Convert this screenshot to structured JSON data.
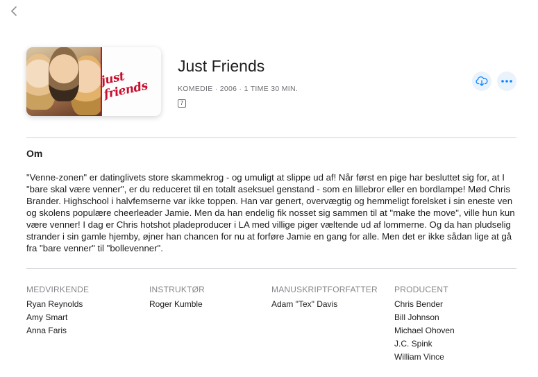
{
  "movie": {
    "title": "Just Friends",
    "meta": "KOMEDIE · 2006 · 1 TIME 30 MIN.",
    "rating": "7",
    "poster_title": "just friends"
  },
  "about": {
    "heading": "Om",
    "text": "\"Venne-zonen\" er datinglivets store skammekrog - og umuligt at slippe ud af! Når først en pige har besluttet sig for, at I \"bare skal være venner\", er du reduceret til en totalt aseksuel genstand - som en lillebror eller en bordlampe! Mød Chris Brander. Highschool i halvfemserne var ikke toppen. Han var genert, overvægtig og hemmeligt forelsket i sin eneste ven og skolens populære cheerleader Jamie. Men da han endelig fik nosset sig sammen til at \"make the move\", ville hun kun være venner! I dag er Chris hotshot pladeproducer i LA med villige piger væltende ud af lommerne. Og da han pludselig strander i sin gamle hjemby, øjner han chancen for nu at forføre Jamie en gang for alle. Men det er ikke sådan lige at gå fra \"bare venner\" til \"bollevenner\"."
  },
  "credits": {
    "cast": {
      "heading": "MEDVIRKENDE",
      "names": [
        "Ryan Reynolds",
        "Amy Smart",
        "Anna Faris"
      ]
    },
    "director": {
      "heading": "INSTRUKTØR",
      "names": [
        "Roger Kumble"
      ]
    },
    "writer": {
      "heading": "MANUSKRIPTFORFATTER",
      "names": [
        "Adam \"Tex\" Davis"
      ]
    },
    "producer": {
      "heading": "PRODUCENT",
      "names": [
        "Chris Bender",
        "Bill Johnson",
        "Michael Ohoven",
        "J.C. Spink",
        "William Vince"
      ]
    }
  },
  "icons": {
    "back": "chevron-left-icon",
    "download": "icloud-download-icon",
    "more": "ellipsis-icon"
  },
  "colors": {
    "accent": "#0a84ff",
    "button_bg": "#eaf2fb",
    "poster_red": "#c8102e"
  }
}
